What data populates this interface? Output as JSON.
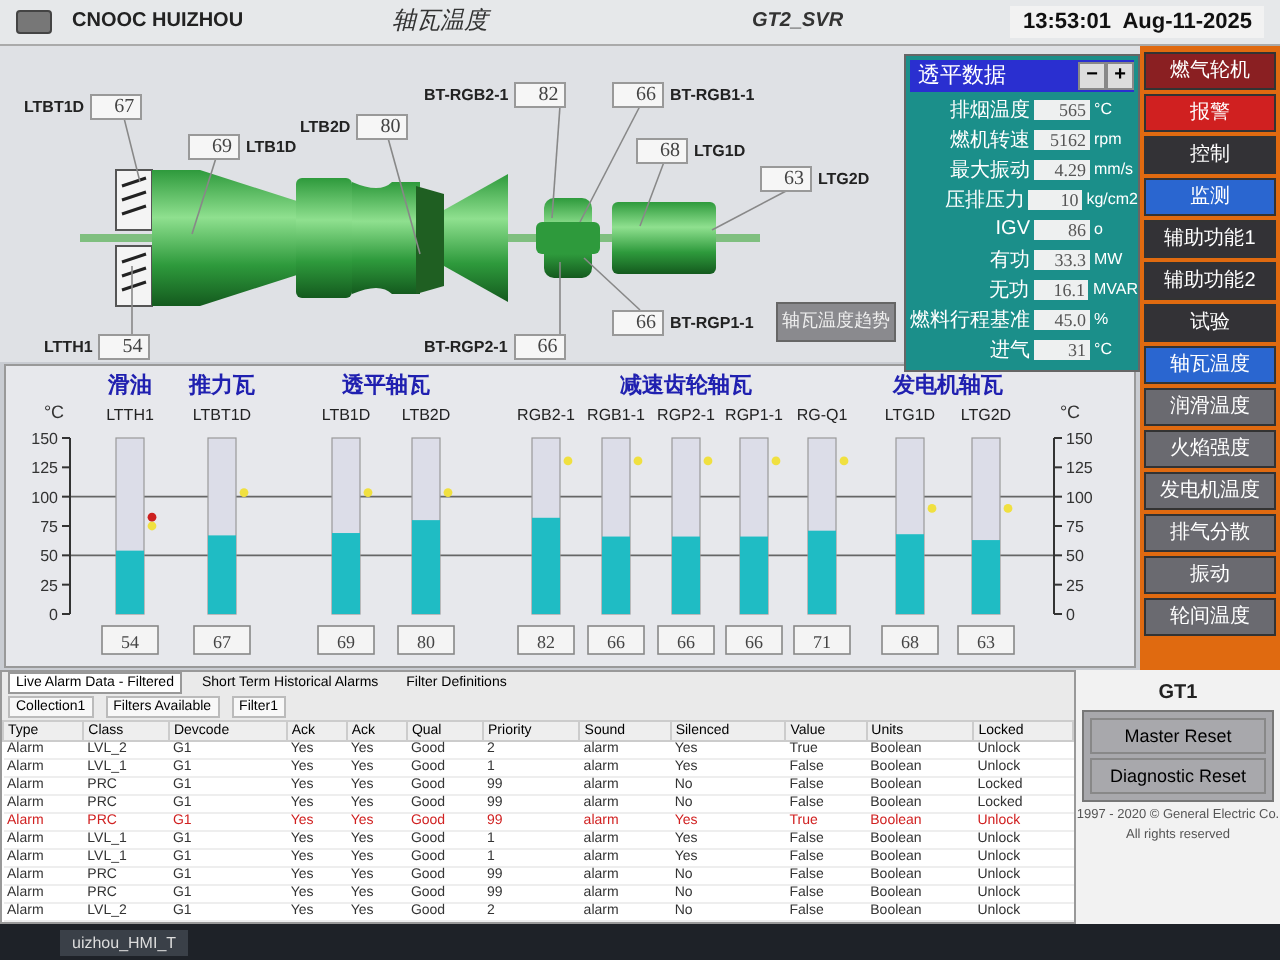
{
  "header": {
    "site": "CNOOC HUIZHOU",
    "title": "轴瓦温度",
    "server": "GT2_SVR",
    "time": "13:53:01",
    "date": "Aug-11-2025"
  },
  "diagram": {
    "tags": [
      {
        "label": "LTBT1D",
        "value": "67"
      },
      {
        "label": "LTB1D",
        "value": "69"
      },
      {
        "label": "LTB2D",
        "value": "80"
      },
      {
        "label": "BT-RGB2-1",
        "value": "82"
      },
      {
        "label": "BT-RGB1-1",
        "value": "66"
      },
      {
        "label": "LTG1D",
        "value": "68"
      },
      {
        "label": "LTG2D",
        "value": "63"
      },
      {
        "label": "LTTH1",
        "value": "54"
      },
      {
        "label": "BT-RGP2-1",
        "value": "66"
      },
      {
        "label": "BT-RGP1-1",
        "value": "66"
      }
    ],
    "trend_button": "轴瓦温度趋势"
  },
  "turbine_data": {
    "title": "透平数据",
    "buttons": [
      "−",
      "+"
    ],
    "rows": [
      {
        "label": "排烟温度",
        "value": "565",
        "unit": "°C"
      },
      {
        "label": "燃机转速",
        "value": "5162",
        "unit": "rpm"
      },
      {
        "label": "最大振动",
        "value": "4.29",
        "unit": "mm/s"
      },
      {
        "label": "压排压力",
        "value": "10",
        "unit": "kg/cm2"
      },
      {
        "label": "IGV",
        "value": "86",
        "unit": "o"
      },
      {
        "label": "有功",
        "value": "33.3",
        "unit": "MW"
      },
      {
        "label": "无功",
        "value": "16.1",
        "unit": "MVAR"
      },
      {
        "label": "燃料行程基准",
        "value": "45.0",
        "unit": "%"
      },
      {
        "label": "进气",
        "value": "31",
        "unit": "°C"
      }
    ]
  },
  "sidebar": {
    "items": [
      {
        "label": "燃气轮机",
        "kind": "header",
        "selected": false
      },
      {
        "label": "报警",
        "kind": "alarm",
        "selected": false
      },
      {
        "label": "控制",
        "kind": "menu",
        "selected": false
      },
      {
        "label": "监测",
        "kind": "menu",
        "selected": true
      },
      {
        "label": "辅助功能1",
        "kind": "menu",
        "selected": false
      },
      {
        "label": "辅助功能2",
        "kind": "menu",
        "selected": false
      },
      {
        "label": "试验",
        "kind": "menu",
        "selected": false
      },
      {
        "label": "轴瓦温度",
        "kind": "page",
        "selected": true
      },
      {
        "label": "润滑温度",
        "kind": "page",
        "selected": false
      },
      {
        "label": "火焰强度",
        "kind": "page",
        "selected": false
      },
      {
        "label": "发电机温度",
        "kind": "page",
        "selected": false
      },
      {
        "label": "排气分散",
        "kind": "page",
        "selected": false
      },
      {
        "label": "振动",
        "kind": "page",
        "selected": false
      },
      {
        "label": "轮间温度",
        "kind": "page",
        "selected": false
      }
    ]
  },
  "bearing_chart": {
    "groups": [
      {
        "label": "滑油"
      },
      {
        "label": "推力瓦"
      },
      {
        "label": "透平轴瓦"
      },
      {
        "label": "减速齿轮轴瓦"
      },
      {
        "label": "发电机轴瓦"
      }
    ],
    "chart_data": {
      "type": "bar",
      "ylabel": "°C",
      "categories": [
        "LTTH1",
        "LTBT1D",
        "LTB1D",
        "LTB2D",
        "RGB2-1",
        "RGB1-1",
        "RGP2-1",
        "RGP1-1",
        "RG-Q1",
        "LTG1D",
        "LTG2D"
      ],
      "values": [
        54,
        67,
        69,
        80,
        82,
        66,
        66,
        66,
        71,
        68,
        63
      ],
      "ylim": [
        0,
        150
      ],
      "yticks": [
        0,
        25,
        50,
        75,
        100,
        125,
        150
      ],
      "value_labels": [
        "54",
        "67",
        "69",
        "80",
        "82",
        "66",
        "66",
        "66",
        "71",
        "68",
        "63"
      ]
    },
    "right_axis": {
      "unit": "°C",
      "ticks": [
        "150",
        "125",
        "100",
        "75",
        "50",
        "25",
        "0"
      ]
    },
    "alarm_markers": [
      {
        "markers": [
          {
            "level": 0.5,
            "color": "#f0e040"
          },
          {
            "level": 0.55,
            "color": "#cc2020"
          }
        ]
      },
      {
        "markers": [
          {
            "level": 0.69,
            "color": "#f0e040"
          }
        ]
      },
      {
        "markers": [
          {
            "level": 0.69,
            "color": "#f0e040"
          }
        ]
      },
      {
        "markers": [
          {
            "level": 0.69,
            "color": "#f0e040"
          }
        ]
      },
      {
        "markers": [
          {
            "level": 0.87,
            "color": "#f0e040"
          }
        ]
      },
      {
        "markers": [
          {
            "level": 0.87,
            "color": "#f0e040"
          }
        ]
      },
      {
        "markers": [
          {
            "level": 0.87,
            "color": "#f0e040"
          }
        ]
      },
      {
        "markers": [
          {
            "level": 0.87,
            "color": "#f0e040"
          }
        ]
      },
      {
        "markers": [
          {
            "level": 0.87,
            "color": "#f0e040"
          }
        ]
      },
      {
        "markers": [
          {
            "level": 0.6,
            "color": "#f0e040"
          }
        ]
      },
      {
        "markers": [
          {
            "level": 0.6,
            "color": "#f0e040"
          }
        ]
      }
    ]
  },
  "alarm_viewer": {
    "tabs": [
      {
        "label": "Live Alarm Data - Filtered",
        "selected": true
      },
      {
        "label": "Short Term Historical Alarms",
        "selected": false
      },
      {
        "label": "Filter Definitions",
        "selected": false
      }
    ],
    "toolbar": [
      "Collection1",
      "Filters Available",
      "Filter1"
    ],
    "columns": [
      "Type",
      "Class",
      "Devcode",
      "Ack",
      "Ack",
      "Qual",
      "Priority",
      "Sound",
      "Silenced",
      "Value",
      "Units",
      "Locked"
    ],
    "rows": [
      {
        "highlighted": false,
        "cells": [
          "Alarm",
          "LVL_2",
          "G1",
          "Yes",
          "Yes",
          "Good",
          "2",
          "alarm",
          "Yes",
          "True",
          "Boolean",
          "Unlock"
        ]
      },
      {
        "highlighted": false,
        "cells": [
          "Alarm",
          "LVL_1",
          "G1",
          "Yes",
          "Yes",
          "Good",
          "1",
          "alarm",
          "Yes",
          "False",
          "Boolean",
          "Unlock"
        ]
      },
      {
        "highlighted": false,
        "cells": [
          "Alarm",
          "PRC",
          "G1",
          "Yes",
          "Yes",
          "Good",
          "99",
          "alarm",
          "No",
          "False",
          "Boolean",
          "Locked"
        ]
      },
      {
        "highlighted": false,
        "cells": [
          "Alarm",
          "PRC",
          "G1",
          "Yes",
          "Yes",
          "Good",
          "99",
          "alarm",
          "No",
          "False",
          "Boolean",
          "Locked"
        ]
      },
      {
        "highlighted": true,
        "cells": [
          "Alarm",
          "PRC",
          "G1",
          "Yes",
          "Yes",
          "Good",
          "99",
          "alarm",
          "Yes",
          "True",
          "Boolean",
          "Unlock"
        ]
      },
      {
        "highlighted": false,
        "cells": [
          "Alarm",
          "LVL_1",
          "G1",
          "Yes",
          "Yes",
          "Good",
          "1",
          "alarm",
          "Yes",
          "False",
          "Boolean",
          "Unlock"
        ]
      },
      {
        "highlighted": false,
        "cells": [
          "Alarm",
          "LVL_1",
          "G1",
          "Yes",
          "Yes",
          "Good",
          "1",
          "alarm",
          "Yes",
          "False",
          "Boolean",
          "Unlock"
        ]
      },
      {
        "highlighted": false,
        "cells": [
          "Alarm",
          "PRC",
          "G1",
          "Yes",
          "Yes",
          "Good",
          "99",
          "alarm",
          "No",
          "False",
          "Boolean",
          "Unlock"
        ]
      },
      {
        "highlighted": false,
        "cells": [
          "Alarm",
          "PRC",
          "G1",
          "Yes",
          "Yes",
          "Good",
          "99",
          "alarm",
          "No",
          "False",
          "Boolean",
          "Unlock"
        ]
      },
      {
        "highlighted": false,
        "cells": [
          "Alarm",
          "LVL_2",
          "G1",
          "Yes",
          "Yes",
          "Good",
          "2",
          "alarm",
          "No",
          "False",
          "Boolean",
          "Unlock"
        ]
      }
    ]
  },
  "gt_panel": {
    "title": "GT1",
    "buttons": [
      "Master Reset",
      "Diagnostic Reset"
    ],
    "copyright": "1997 - 2020 © General Electric Co.",
    "rights": "All rights reserved"
  },
  "taskbar": {
    "window": "uizhou_HMI_T"
  }
}
